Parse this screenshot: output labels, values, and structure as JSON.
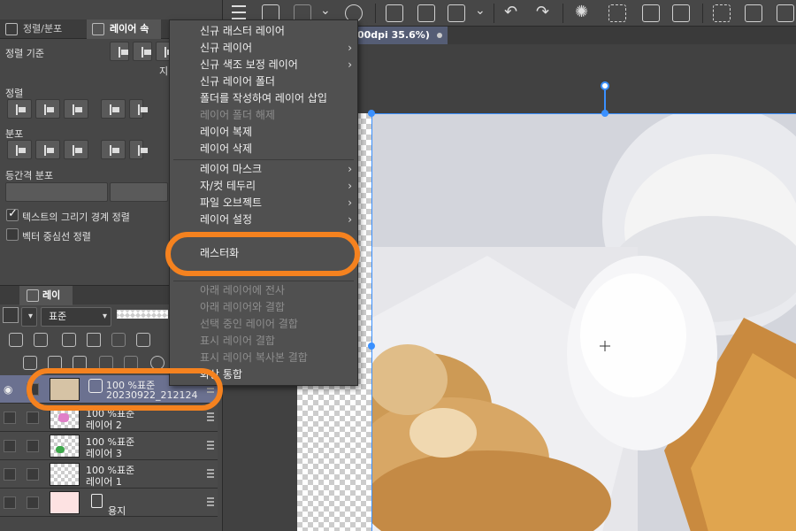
{
  "left_panel": {
    "tabs": [
      {
        "label": "정렬/분포"
      },
      {
        "label": "레이어 속성"
      }
    ],
    "align_basis_label": "정렬 기준",
    "align_basis_value": "지",
    "align_label": "정렬",
    "distribute_label": "분포",
    "equal_spacing_label": "등간격 분포",
    "checkbox_text_bounds": {
      "label": "텍스트의 그리기 경계 정렬",
      "checked": true
    },
    "checkbox_vector_center": {
      "label": "벡터 중심선 정렬",
      "checked": false
    }
  },
  "layer_panel": {
    "tab_label": "레이어",
    "blend_mode": "표준",
    "layers": [
      {
        "line1": "100 %표준",
        "line2": "20230922_212124",
        "selected": true,
        "visible": true
      },
      {
        "line1": "100 %표준",
        "line2": "레이어 2",
        "selected": false,
        "visible": false
      },
      {
        "line1": "100 %표준",
        "line2": "레이어 3",
        "selected": false,
        "visible": false
      },
      {
        "line1": "100 %표준",
        "line2": "레이어 1",
        "selected": false,
        "visible": false
      },
      {
        "line1": "",
        "line2": "용지",
        "selected": false,
        "visible": false
      }
    ]
  },
  "document": {
    "tab_label": "00dpi 35.6%)"
  },
  "context_menu": {
    "items": [
      {
        "label": "신규 래스터 레이어",
        "enabled": true,
        "submenu": false
      },
      {
        "label": "신규 레이어",
        "enabled": true,
        "submenu": true
      },
      {
        "label": "신규 색조 보정 레이어",
        "enabled": true,
        "submenu": true
      },
      {
        "label": "신규 레이어 폴더",
        "enabled": true,
        "submenu": false
      },
      {
        "label": "폴더를 작성하여 레이어 삽입",
        "enabled": true,
        "submenu": false
      },
      {
        "label": "레이어 폴더 해제",
        "enabled": false,
        "submenu": false
      },
      {
        "label": "레이어 복제",
        "enabled": true,
        "submenu": false
      },
      {
        "label": "레이어 삭제",
        "enabled": true,
        "submenu": false
      },
      {
        "label": "레이어 마스크",
        "enabled": true,
        "submenu": true
      },
      {
        "label": "자/컷 테두리",
        "enabled": true,
        "submenu": true
      },
      {
        "label": "파일 오브젝트",
        "enabled": true,
        "submenu": true
      },
      {
        "label": "레이어 설정",
        "enabled": true,
        "submenu": true
      },
      {
        "label": "래스터화",
        "enabled": true,
        "submenu": false
      },
      {
        "label": "아래 레이어에 전사",
        "enabled": false,
        "submenu": false
      },
      {
        "label": "아래 레이어와 결합",
        "enabled": false,
        "submenu": false
      },
      {
        "label": "선택 중인 레이어 결합",
        "enabled": false,
        "submenu": false
      },
      {
        "label": "표시 레이어 결합",
        "enabled": false,
        "submenu": false
      },
      {
        "label": "표시 레이어 복사본 결합",
        "enabled": false,
        "submenu": false
      },
      {
        "label": "화상 통합",
        "enabled": true,
        "submenu": false
      }
    ],
    "submenu_arrow": "›"
  },
  "colors": {
    "highlight": "#f5821f",
    "selection": "#3a90ff",
    "selected_layer": "#6b7190"
  }
}
